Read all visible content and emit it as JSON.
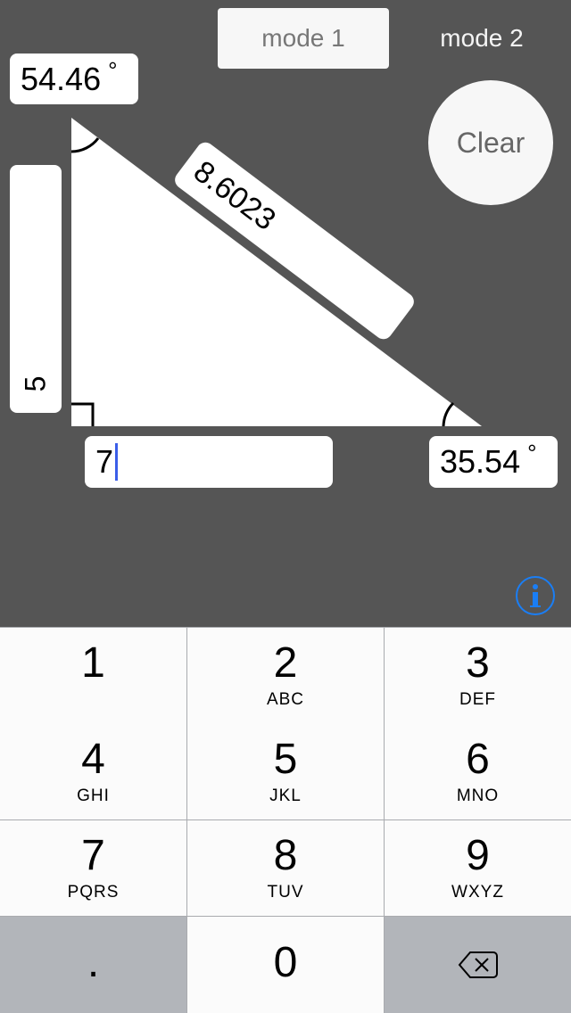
{
  "modes": {
    "mode1": "mode 1",
    "mode2": "mode 2"
  },
  "clear_label": "Clear",
  "angle_top": {
    "value": "54.46",
    "unit": "°"
  },
  "angle_bottom": {
    "value": "35.54",
    "unit": "°"
  },
  "side_vertical": "5",
  "side_horizontal": "7",
  "hypotenuse": "8.6023",
  "info_icon": "info-icon",
  "accent_color": "#1a7ef5",
  "keypad": [
    {
      "digit": "1",
      "letters": ""
    },
    {
      "digit": "2",
      "letters": "ABC"
    },
    {
      "digit": "3",
      "letters": "DEF"
    },
    {
      "digit": "4",
      "letters": "GHI"
    },
    {
      "digit": "5",
      "letters": "JKL"
    },
    {
      "digit": "6",
      "letters": "MNO"
    },
    {
      "digit": "7",
      "letters": "PQRS"
    },
    {
      "digit": "8",
      "letters": "TUV"
    },
    {
      "digit": "9",
      "letters": "WXYZ"
    },
    {
      "digit": ".",
      "letters": ""
    },
    {
      "digit": "0",
      "letters": ""
    },
    {
      "digit": "",
      "letters": "",
      "icon": "backspace-icon"
    }
  ]
}
